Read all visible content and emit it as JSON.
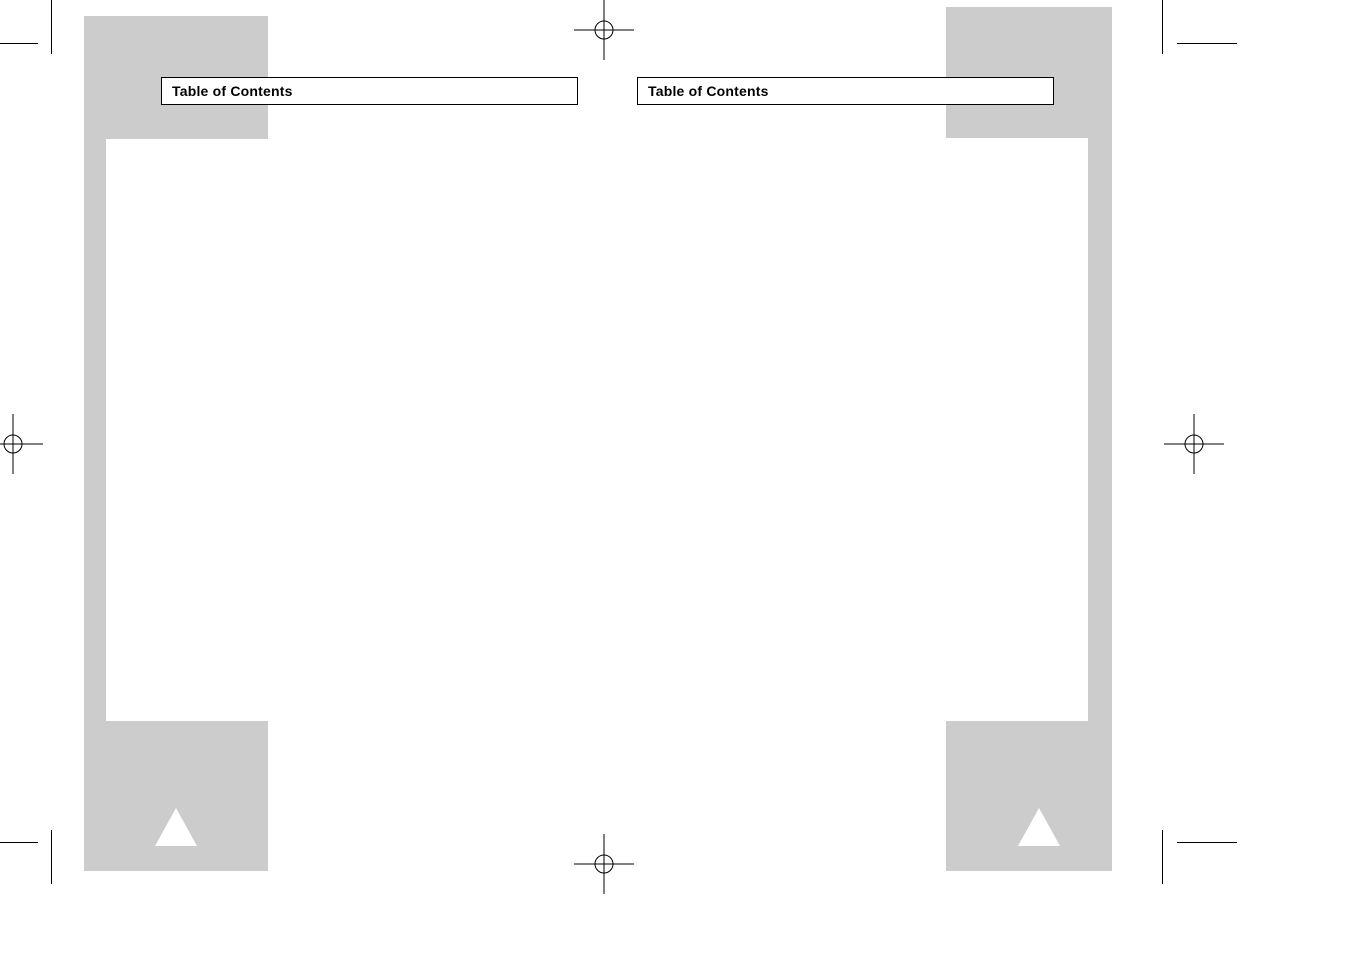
{
  "left_page": {
    "title": "Table of Contents"
  },
  "right_page": {
    "title": "Table of Contents"
  }
}
